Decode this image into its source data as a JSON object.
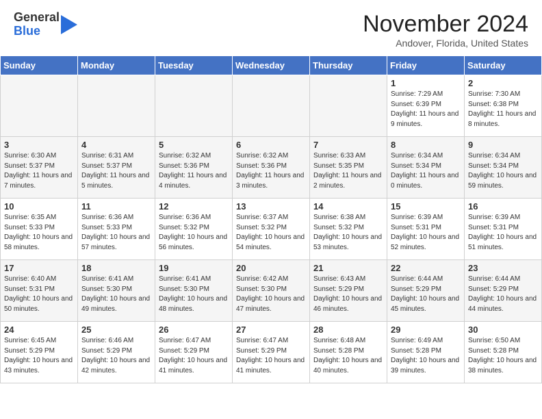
{
  "header": {
    "logo_general": "General",
    "logo_blue": "Blue",
    "month_title": "November 2024",
    "location": "Andover, Florida, United States"
  },
  "weekdays": [
    "Sunday",
    "Monday",
    "Tuesday",
    "Wednesday",
    "Thursday",
    "Friday",
    "Saturday"
  ],
  "weeks": [
    [
      {
        "day": "",
        "sunrise": "",
        "sunset": "",
        "daylight": "",
        "empty": true
      },
      {
        "day": "",
        "sunrise": "",
        "sunset": "",
        "daylight": "",
        "empty": true
      },
      {
        "day": "",
        "sunrise": "",
        "sunset": "",
        "daylight": "",
        "empty": true
      },
      {
        "day": "",
        "sunrise": "",
        "sunset": "",
        "daylight": "",
        "empty": true
      },
      {
        "day": "",
        "sunrise": "",
        "sunset": "",
        "daylight": "",
        "empty": true
      },
      {
        "day": "1",
        "sunrise": "Sunrise: 7:29 AM",
        "sunset": "Sunset: 6:39 PM",
        "daylight": "Daylight: 11 hours and 9 minutes.",
        "empty": false
      },
      {
        "day": "2",
        "sunrise": "Sunrise: 7:30 AM",
        "sunset": "Sunset: 6:38 PM",
        "daylight": "Daylight: 11 hours and 8 minutes.",
        "empty": false
      }
    ],
    [
      {
        "day": "3",
        "sunrise": "Sunrise: 6:30 AM",
        "sunset": "Sunset: 5:37 PM",
        "daylight": "Daylight: 11 hours and 7 minutes.",
        "empty": false
      },
      {
        "day": "4",
        "sunrise": "Sunrise: 6:31 AM",
        "sunset": "Sunset: 5:37 PM",
        "daylight": "Daylight: 11 hours and 5 minutes.",
        "empty": false
      },
      {
        "day": "5",
        "sunrise": "Sunrise: 6:32 AM",
        "sunset": "Sunset: 5:36 PM",
        "daylight": "Daylight: 11 hours and 4 minutes.",
        "empty": false
      },
      {
        "day": "6",
        "sunrise": "Sunrise: 6:32 AM",
        "sunset": "Sunset: 5:36 PM",
        "daylight": "Daylight: 11 hours and 3 minutes.",
        "empty": false
      },
      {
        "day": "7",
        "sunrise": "Sunrise: 6:33 AM",
        "sunset": "Sunset: 5:35 PM",
        "daylight": "Daylight: 11 hours and 2 minutes.",
        "empty": false
      },
      {
        "day": "8",
        "sunrise": "Sunrise: 6:34 AM",
        "sunset": "Sunset: 5:34 PM",
        "daylight": "Daylight: 11 hours and 0 minutes.",
        "empty": false
      },
      {
        "day": "9",
        "sunrise": "Sunrise: 6:34 AM",
        "sunset": "Sunset: 5:34 PM",
        "daylight": "Daylight: 10 hours and 59 minutes.",
        "empty": false
      }
    ],
    [
      {
        "day": "10",
        "sunrise": "Sunrise: 6:35 AM",
        "sunset": "Sunset: 5:33 PM",
        "daylight": "Daylight: 10 hours and 58 minutes.",
        "empty": false
      },
      {
        "day": "11",
        "sunrise": "Sunrise: 6:36 AM",
        "sunset": "Sunset: 5:33 PM",
        "daylight": "Daylight: 10 hours and 57 minutes.",
        "empty": false
      },
      {
        "day": "12",
        "sunrise": "Sunrise: 6:36 AM",
        "sunset": "Sunset: 5:32 PM",
        "daylight": "Daylight: 10 hours and 56 minutes.",
        "empty": false
      },
      {
        "day": "13",
        "sunrise": "Sunrise: 6:37 AM",
        "sunset": "Sunset: 5:32 PM",
        "daylight": "Daylight: 10 hours and 54 minutes.",
        "empty": false
      },
      {
        "day": "14",
        "sunrise": "Sunrise: 6:38 AM",
        "sunset": "Sunset: 5:32 PM",
        "daylight": "Daylight: 10 hours and 53 minutes.",
        "empty": false
      },
      {
        "day": "15",
        "sunrise": "Sunrise: 6:39 AM",
        "sunset": "Sunset: 5:31 PM",
        "daylight": "Daylight: 10 hours and 52 minutes.",
        "empty": false
      },
      {
        "day": "16",
        "sunrise": "Sunrise: 6:39 AM",
        "sunset": "Sunset: 5:31 PM",
        "daylight": "Daylight: 10 hours and 51 minutes.",
        "empty": false
      }
    ],
    [
      {
        "day": "17",
        "sunrise": "Sunrise: 6:40 AM",
        "sunset": "Sunset: 5:31 PM",
        "daylight": "Daylight: 10 hours and 50 minutes.",
        "empty": false
      },
      {
        "day": "18",
        "sunrise": "Sunrise: 6:41 AM",
        "sunset": "Sunset: 5:30 PM",
        "daylight": "Daylight: 10 hours and 49 minutes.",
        "empty": false
      },
      {
        "day": "19",
        "sunrise": "Sunrise: 6:41 AM",
        "sunset": "Sunset: 5:30 PM",
        "daylight": "Daylight: 10 hours and 48 minutes.",
        "empty": false
      },
      {
        "day": "20",
        "sunrise": "Sunrise: 6:42 AM",
        "sunset": "Sunset: 5:30 PM",
        "daylight": "Daylight: 10 hours and 47 minutes.",
        "empty": false
      },
      {
        "day": "21",
        "sunrise": "Sunrise: 6:43 AM",
        "sunset": "Sunset: 5:29 PM",
        "daylight": "Daylight: 10 hours and 46 minutes.",
        "empty": false
      },
      {
        "day": "22",
        "sunrise": "Sunrise: 6:44 AM",
        "sunset": "Sunset: 5:29 PM",
        "daylight": "Daylight: 10 hours and 45 minutes.",
        "empty": false
      },
      {
        "day": "23",
        "sunrise": "Sunrise: 6:44 AM",
        "sunset": "Sunset: 5:29 PM",
        "daylight": "Daylight: 10 hours and 44 minutes.",
        "empty": false
      }
    ],
    [
      {
        "day": "24",
        "sunrise": "Sunrise: 6:45 AM",
        "sunset": "Sunset: 5:29 PM",
        "daylight": "Daylight: 10 hours and 43 minutes.",
        "empty": false
      },
      {
        "day": "25",
        "sunrise": "Sunrise: 6:46 AM",
        "sunset": "Sunset: 5:29 PM",
        "daylight": "Daylight: 10 hours and 42 minutes.",
        "empty": false
      },
      {
        "day": "26",
        "sunrise": "Sunrise: 6:47 AM",
        "sunset": "Sunset: 5:29 PM",
        "daylight": "Daylight: 10 hours and 41 minutes.",
        "empty": false
      },
      {
        "day": "27",
        "sunrise": "Sunrise: 6:47 AM",
        "sunset": "Sunset: 5:29 PM",
        "daylight": "Daylight: 10 hours and 41 minutes.",
        "empty": false
      },
      {
        "day": "28",
        "sunrise": "Sunrise: 6:48 AM",
        "sunset": "Sunset: 5:28 PM",
        "daylight": "Daylight: 10 hours and 40 minutes.",
        "empty": false
      },
      {
        "day": "29",
        "sunrise": "Sunrise: 6:49 AM",
        "sunset": "Sunset: 5:28 PM",
        "daylight": "Daylight: 10 hours and 39 minutes.",
        "empty": false
      },
      {
        "day": "30",
        "sunrise": "Sunrise: 6:50 AM",
        "sunset": "Sunset: 5:28 PM",
        "daylight": "Daylight: 10 hours and 38 minutes.",
        "empty": false
      }
    ]
  ]
}
